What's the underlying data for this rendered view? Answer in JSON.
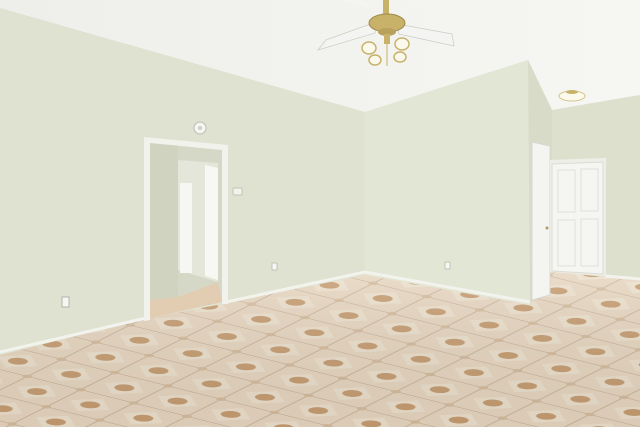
{
  "scene": {
    "colors": {
      "ceiling": "#f1f1ee",
      "wall_left": "#dfe2d0",
      "wall_back": "#e2e6d4",
      "wall_right": "#dde0cd",
      "trim": "#f3f3ee",
      "door": "#f4f4f1",
      "floor_tile": "#e7d6c0",
      "floor_grout": "#c9b59d",
      "tile_motif": "#c69d72",
      "fan_metal": "#c8b26a",
      "fan_blade": "#f4f4f2",
      "light_glass": "#fbf8ec"
    },
    "icons": [
      "ceiling-fan-icon",
      "ceiling-light-icon",
      "thermostat-icon",
      "smoke-detector-icon",
      "outlet-icon"
    ]
  }
}
